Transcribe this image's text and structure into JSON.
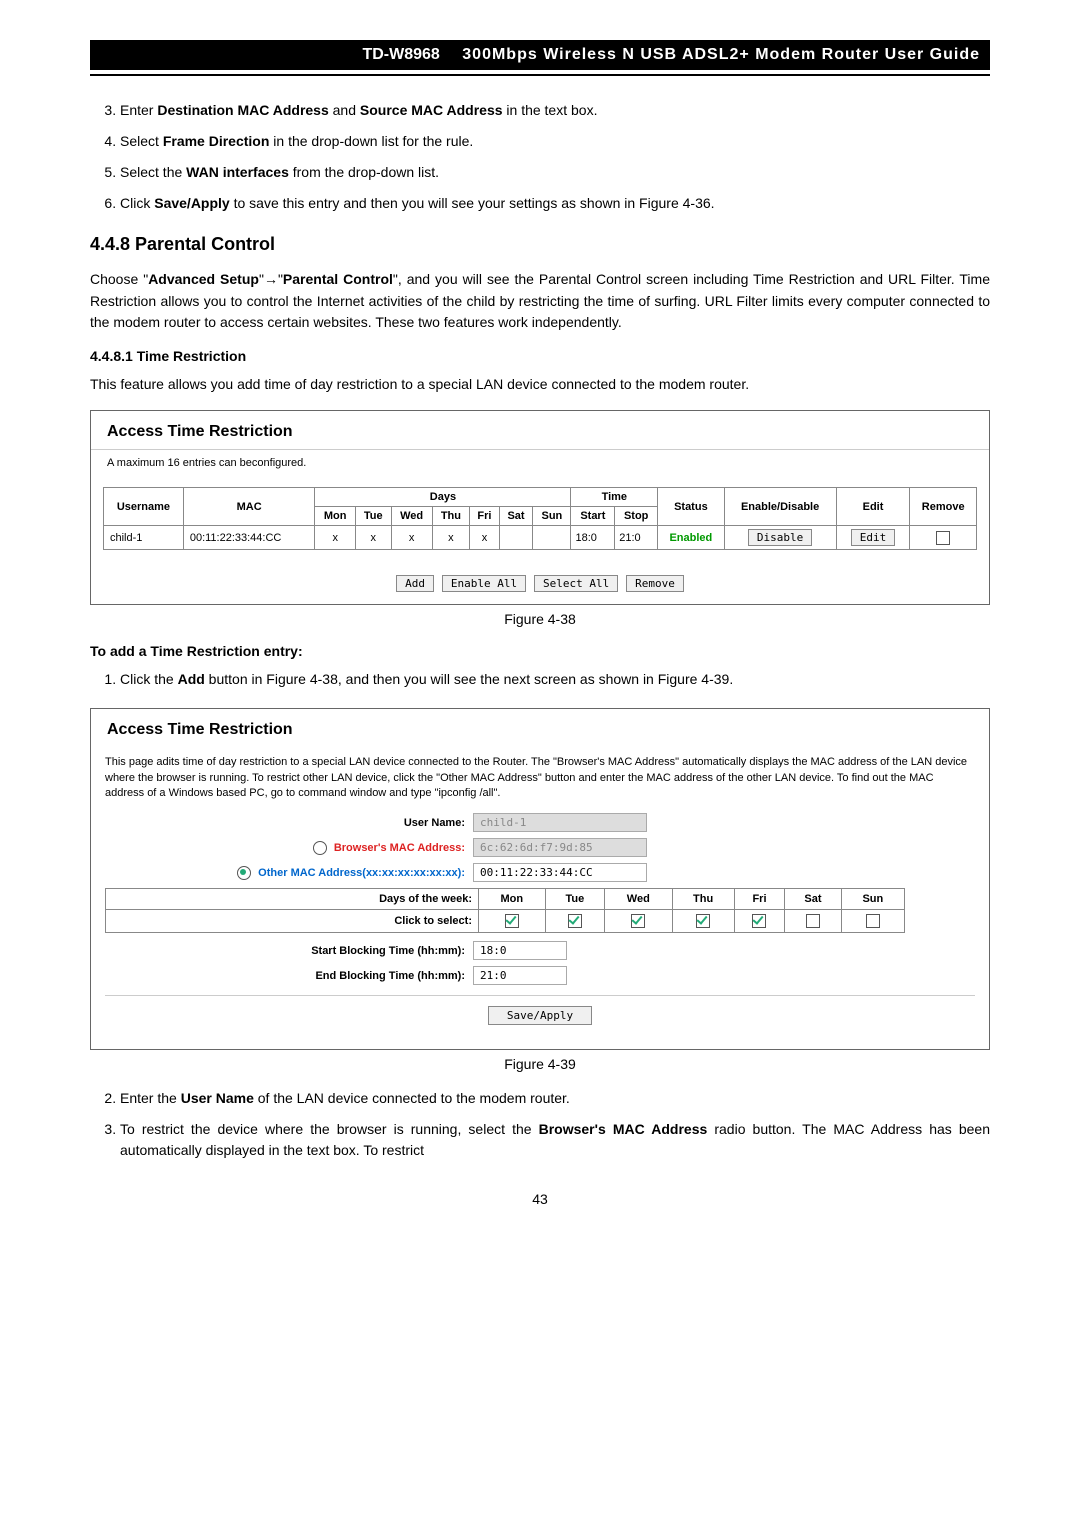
{
  "header": {
    "model": "TD-W8968",
    "title": "300Mbps Wireless N USB ADSL2+ Modem Router User Guide"
  },
  "steps_top": {
    "s3_prefix": "Enter ",
    "s3_b1": "Destination MAC Address",
    "s3_mid": " and ",
    "s3_b2": "Source MAC Address",
    "s3_suffix": " in the text box.",
    "s4_prefix": "Select ",
    "s4_b": "Frame Direction",
    "s4_suffix": " in the drop-down list for the rule.",
    "s5_prefix": "Select the ",
    "s5_b": "WAN interfaces",
    "s5_suffix": " from the drop-down list.",
    "s6_prefix": "Click ",
    "s6_b": "Save/Apply",
    "s6_suffix": " to save this entry and then you will see your settings as shown in Figure 4-36."
  },
  "section": {
    "heading": "4.4.8  Parental Control",
    "para_prefix": "Choose \"",
    "para_b1": "Advanced Setup",
    "para_mid1": "\"",
    "para_arrow": "→",
    "para_mid2": "\"",
    "para_b2": "Parental Control",
    "para_suffix": "\", and you will see the Parental Control screen including Time Restriction and URL Filter. Time Restriction allows you to control the Internet activities of the child by restricting the time of surfing. URL Filter limits every computer connected to the modem router to access certain websites. These two features work independently."
  },
  "timerestrict": {
    "heading": "4.4.8.1   Time Restriction",
    "para": "This feature allows you add time of day restriction to a special LAN device connected to the modem router."
  },
  "fig38": {
    "title": "Access Time Restriction",
    "subtitle": "A maximum 16 entries can beconfigured.",
    "cols": {
      "username": "Username",
      "mac": "MAC",
      "days": "Days",
      "mon": "Mon",
      "tue": "Tue",
      "wed": "Wed",
      "thu": "Thu",
      "fri": "Fri",
      "sat": "Sat",
      "sun": "Sun",
      "time": "Time",
      "start": "Start",
      "stop": "Stop",
      "status": "Status",
      "enabledisable": "Enable/Disable",
      "edit": "Edit",
      "remove": "Remove"
    },
    "row": {
      "username": "child-1",
      "mac": "00:11:22:33:44:CC",
      "mon": "x",
      "tue": "x",
      "wed": "x",
      "thu": "x",
      "fri": "x",
      "sat": "",
      "sun": "",
      "start": "18:0",
      "stop": "21:0",
      "status": "Enabled",
      "disable_btn": "Disable",
      "edit_btn": "Edit"
    },
    "btns": {
      "add": "Add",
      "enable_all": "Enable All",
      "select_all": "Select All",
      "remove": "Remove"
    },
    "caption": "Figure 4-38"
  },
  "addentry": {
    "heading": "To add a Time Restriction entry:",
    "step1_prefix": "Click the ",
    "step1_b": "Add",
    "step1_suffix": " button in Figure 4-38, and then you will see the next screen as shown in Figure 4-39."
  },
  "fig39": {
    "title": "Access Time Restriction",
    "desc": "This page adits time of day restriction to a special LAN device connected to the Router. The \"Browser's MAC Address\" automatically displays the MAC address of the LAN device where the browser is running. To restrict other LAN device, click the \"Other MAC Address\" button and enter the MAC address of the other LAN device. To find out the MAC address of a Windows based PC, go to command window and type \"ipconfig /all\".",
    "fields": {
      "username_lbl": "User Name:",
      "username_val": "child-1",
      "browser_mac_lbl": "Browser's MAC Address:",
      "browser_mac_val": "6c:62:6d:f7:9d:85",
      "other_mac_lbl": "Other MAC Address(xx:xx:xx:xx:xx:xx):",
      "other_mac_val": "00:11:22:33:44:CC",
      "days_lbl": "Days of the week:",
      "click_lbl": "Click to select:",
      "mon": "Mon",
      "tue": "Tue",
      "wed": "Wed",
      "thu": "Thu",
      "fri": "Fri",
      "sat": "Sat",
      "sun": "Sun",
      "start_lbl": "Start Blocking Time (hh:mm):",
      "start_val": "18:0",
      "end_lbl": "End Blocking Time (hh:mm):",
      "end_val": "21:0"
    },
    "save_btn": "Save/Apply",
    "caption": "Figure 4-39"
  },
  "steps_bottom": {
    "s2_prefix": "Enter the ",
    "s2_b": "User Name",
    "s2_suffix": " of the LAN device connected to the modem router.",
    "s3_prefix": "To restrict the device where the browser is running, select the ",
    "s3_b": "Browser's MAC Address",
    "s3_suffix": " radio button. The MAC Address has been automatically displayed in the text box. To restrict"
  },
  "page_number": "43"
}
